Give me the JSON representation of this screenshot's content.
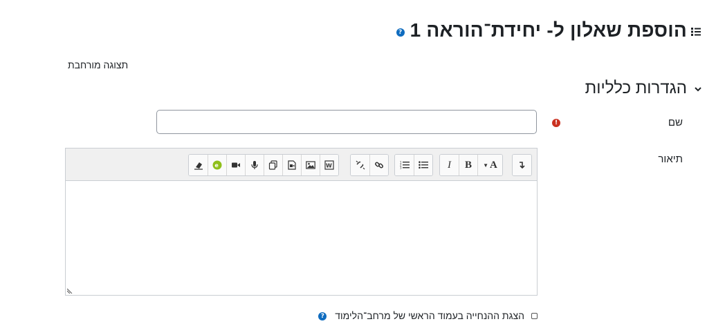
{
  "page": {
    "title": "הוספת שאלון ל- יחידת־הוראה 1",
    "title_icon": "list-icon",
    "help_icon": "help-icon"
  },
  "form": {
    "expand_all_label": "תצוגה מורחבת",
    "section": {
      "title": "הגדרות כלליות",
      "expanded": true
    },
    "name": {
      "label": "שם",
      "value": "",
      "required": true
    },
    "description": {
      "label": "תיאור",
      "value": "",
      "toolbar": [
        [
          "show-more-icon"
        ],
        [
          "font-color-icon",
          "bold-icon",
          "italic-icon"
        ],
        [
          "unordered-list-icon",
          "ordered-list-icon"
        ],
        [
          "link-icon",
          "unlink-icon"
        ],
        [
          "word-import-icon",
          "image-icon",
          "media-icon",
          "manage-files-icon",
          "record-audio-icon",
          "record-video-icon",
          "h5p-icon",
          "clear-formatting-icon"
        ]
      ]
    },
    "show_description": {
      "label": "הצגת ההנחייה בעמוד הראשי של מרחב־הלימוד",
      "checked": false
    }
  },
  "colors": {
    "text": "#1d2125",
    "help": "#0f6cbf",
    "required": "#ca3120",
    "toolbar_bg": "#f0f0f0"
  }
}
